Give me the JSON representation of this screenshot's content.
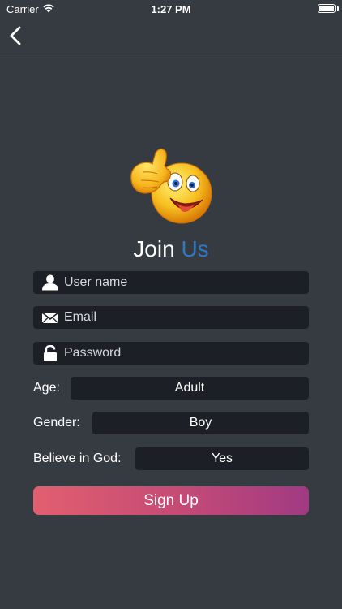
{
  "status_bar": {
    "carrier": "Carrier",
    "time": "1:27 PM",
    "icons": [
      "wifi-icon",
      "battery-icon"
    ]
  },
  "nav": {
    "back_icon": "chevron-left-icon"
  },
  "header": {
    "title_part1": "Join",
    "title_part2": "Us",
    "title_part2_color": "#2f78c4",
    "image": "thumbs-up-emoji"
  },
  "form": {
    "username": {
      "placeholder": "User name",
      "value": "",
      "icon": "user-icon"
    },
    "email": {
      "placeholder": "Email",
      "value": "",
      "icon": "envelope-icon"
    },
    "password": {
      "placeholder": "Password",
      "value": "",
      "icon": "lock-icon"
    },
    "age": {
      "label": "Age:",
      "value": "Adult"
    },
    "gender": {
      "label": "Gender:",
      "value": "Boy"
    },
    "believe": {
      "label": "Believe in God:",
      "value": "Yes"
    },
    "signup_label": "Sign Up"
  },
  "colors": {
    "background": "#363b42",
    "field": "#1c1f25",
    "button_gradient_start": "#e25f6f",
    "button_gradient_end": "#a03a83"
  }
}
